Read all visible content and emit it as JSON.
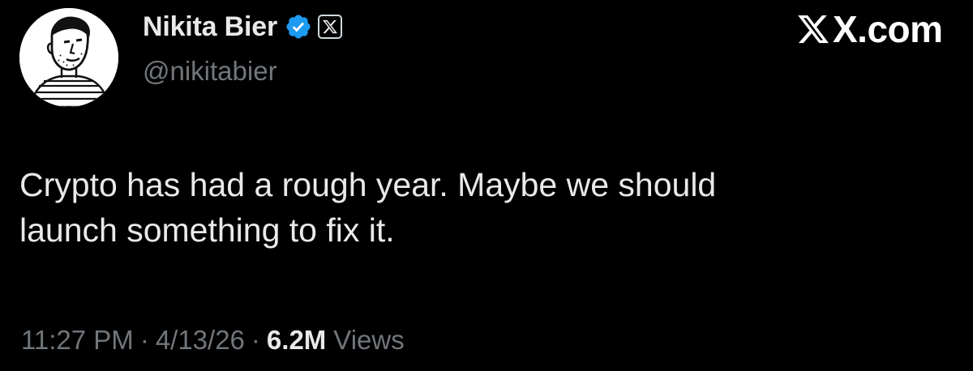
{
  "author": {
    "display_name": "Nikita Bier",
    "handle": "@nikitabier",
    "avatar_icon": "profile-photo",
    "verified": true,
    "badge_color": "#1d9bf0",
    "affiliate_badge_icon": "x-logo-icon"
  },
  "brand": {
    "text": "X.com",
    "logo_icon": "x-logo-icon"
  },
  "tweet": {
    "text_lines": [
      "Crypto has had a rough year. Maybe we should",
      "launch something to fix it."
    ]
  },
  "meta": {
    "time": "11:27 PM",
    "separator": "·",
    "date": "4/13/26",
    "views_count": "6.2M",
    "views_label": "Views"
  },
  "colors": {
    "background": "#000000",
    "primary_text": "#e7e9ea",
    "secondary_text": "#71767b",
    "verified_blue": "#1d9bf0"
  }
}
